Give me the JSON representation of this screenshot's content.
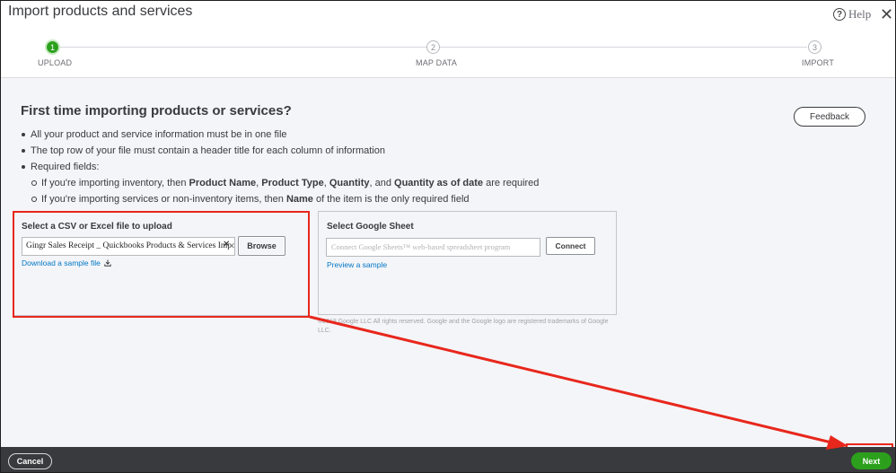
{
  "window": {
    "title": "Import products and services",
    "help_label": "Help",
    "help_icon_glyph": "?",
    "close_glyph": "✕"
  },
  "stepper": {
    "steps": [
      {
        "number": "1",
        "label": "UPLOAD",
        "state": "active"
      },
      {
        "number": "2",
        "label": "MAP DATA",
        "state": "inactive"
      },
      {
        "number": "3",
        "label": "IMPORT",
        "state": "inactive"
      }
    ]
  },
  "intro": {
    "heading": "First time importing products or services?",
    "feedback_label": "Feedback",
    "bullets": [
      "All your product and service information must be in one file",
      "The top row of your file must contain a header title for each column of information",
      "Required fields:"
    ],
    "sub_bullets": {
      "inventory": {
        "prefix": "If you're importing inventory, then ",
        "f1": "Product Name",
        "sep1": ", ",
        "f2": "Product Type",
        "sep2": ", ",
        "f3": "Quantity",
        "sep3": ", and ",
        "f4": "Quantity as of date",
        "suffix": " are required"
      },
      "services": {
        "prefix": "If you're importing services or non-inventory items, then ",
        "f1": "Name",
        "suffix": " of the item is the only required field"
      }
    }
  },
  "csv_panel": {
    "title": "Select a CSV or Excel file to upload",
    "file_value": "Gingr Sales Receipt _ Quickbooks Products & Services Import",
    "clear_glyph": "✕",
    "browse_label": "Browse",
    "sample_link": "Download a sample file"
  },
  "google_panel": {
    "title": "Select Google Sheet",
    "placeholder": "Connect Google Sheets™ web-based spreadsheet program",
    "connect_label": "Connect",
    "preview_link": "Preview a sample",
    "copyright": "©2018 Google LLC All rights reserved. Google and the Google logo are registered trademarks of Google LLC."
  },
  "footer": {
    "cancel_label": "Cancel",
    "next_label": "Next"
  },
  "colors": {
    "primary_green": "#2ca01c",
    "link_blue": "#0077c5",
    "annotation_red": "#e8271c",
    "footer_bg": "#393a3d"
  }
}
